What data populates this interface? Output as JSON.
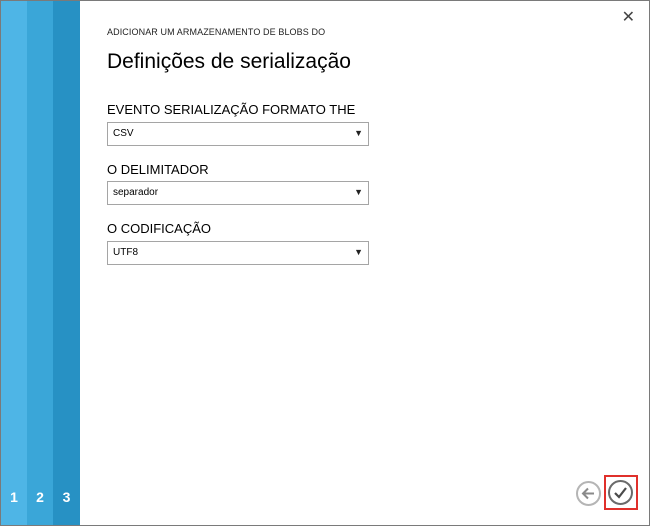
{
  "wizard": {
    "steps": [
      "1",
      "2",
      "3"
    ],
    "subtitle": "ADICIONAR UM ARMAZENAMENTO DE BLOBS DO",
    "title": "Definições de serialização",
    "close_icon": "✕"
  },
  "fields": [
    {
      "label": "EVENTO SERIALIZAÇÃO FORMATO THE",
      "value": "CSV"
    },
    {
      "label": "O DELIMITADOR",
      "value": "separador"
    },
    {
      "label": "O CODIFICAÇÃO",
      "value": "UTF8"
    }
  ],
  "nav": {
    "back_icon": "arrow-left-icon",
    "confirm_icon": "checkmark-icon",
    "highlight_color": "#e0302b"
  },
  "colors": {
    "step1": "#4eb5e6",
    "step2": "#3aa6d8",
    "step3": "#2791c4"
  }
}
